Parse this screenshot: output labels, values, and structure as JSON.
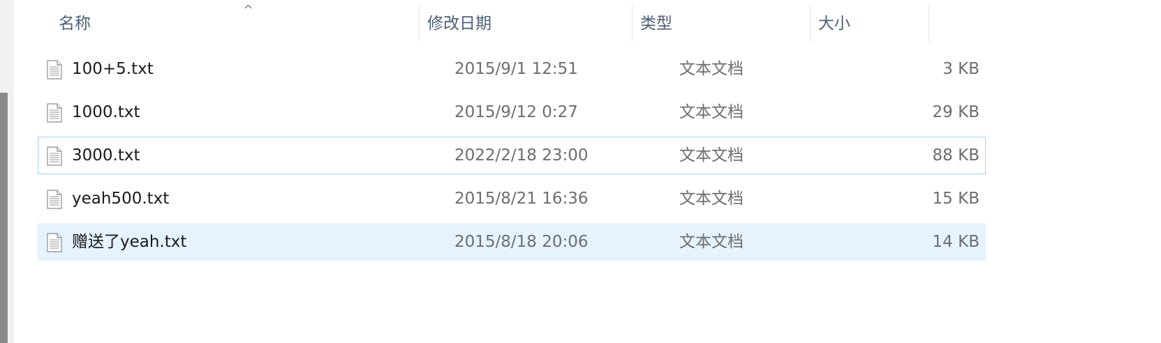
{
  "header": {
    "sort_caret": "^",
    "columns": {
      "name": "名称",
      "date": "修改日期",
      "type": "类型",
      "size": "大小"
    }
  },
  "files": [
    {
      "name": "100+5.txt",
      "date": "2015/9/1 12:51",
      "type": "文本文档",
      "size": "3 KB",
      "icon": "text-file-icon"
    },
    {
      "name": "1000.txt",
      "date": "2015/9/12 0:27",
      "type": "文本文档",
      "size": "29 KB",
      "icon": "text-file-icon"
    },
    {
      "name": "3000.txt",
      "date": "2022/2/18 23:00",
      "type": "文本文档",
      "size": "88 KB",
      "icon": "text-file-icon",
      "state": "focused"
    },
    {
      "name": "yeah500.txt",
      "date": "2015/8/21 16:36",
      "type": "文本文档",
      "size": "15 KB",
      "icon": "text-file-icon"
    },
    {
      "name": "赠送了yeah.txt",
      "date": "2015/8/18 20:06",
      "type": "文本文档",
      "size": "14 KB",
      "icon": "text-file-icon",
      "state": "selected"
    }
  ],
  "colors": {
    "header_text": "#4c607a",
    "focus_border": "#99d1ff",
    "selection_bg": "#e5f3ff"
  }
}
